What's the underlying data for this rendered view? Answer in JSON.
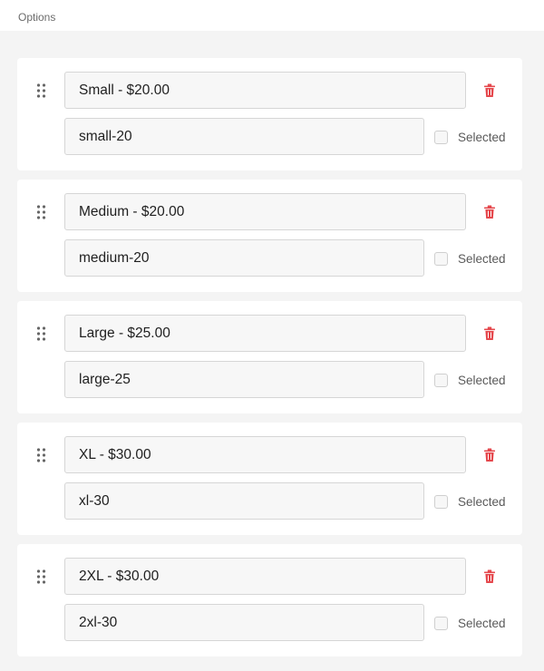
{
  "section_title": "Options",
  "selected_label": "Selected",
  "colors": {
    "delete_icon": "#e5484d",
    "drag_handle": "#666666"
  },
  "options": [
    {
      "label": "Small - $20.00",
      "value": "small-20",
      "selected": false
    },
    {
      "label": "Medium - $20.00",
      "value": "medium-20",
      "selected": false
    },
    {
      "label": "Large - $25.00",
      "value": "large-25",
      "selected": false
    },
    {
      "label": "XL - $30.00",
      "value": "xl-30",
      "selected": false
    },
    {
      "label": "2XL - $30.00",
      "value": "2xl-30",
      "selected": false
    }
  ]
}
